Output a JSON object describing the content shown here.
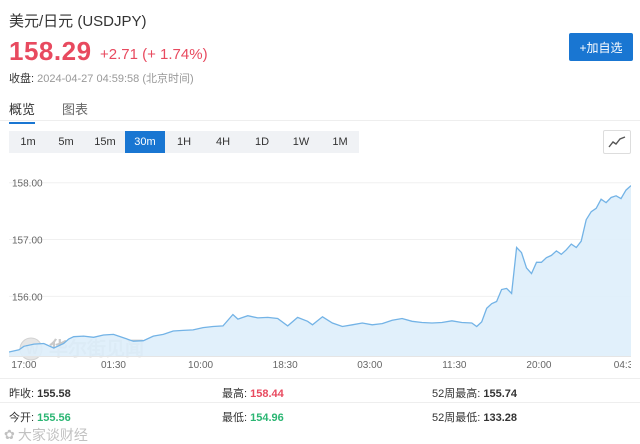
{
  "header": {
    "title": "美元/日元 (USDJPY)",
    "price": "158.29",
    "change": "+2.71 (+ 1.74%)",
    "status_label": "收盘:",
    "timestamp": "2024-04-27 04:59:58 (北京时间)",
    "watch_button": "+加自选"
  },
  "tabs": [
    {
      "label": "概览",
      "active": true
    },
    {
      "label": "图表",
      "active": false
    }
  ],
  "intervals": [
    {
      "label": "1m",
      "active": false
    },
    {
      "label": "5m",
      "active": false
    },
    {
      "label": "15m",
      "active": false
    },
    {
      "label": "30m",
      "active": true
    },
    {
      "label": "1H",
      "active": false
    },
    {
      "label": "4H",
      "active": false
    },
    {
      "label": "1D",
      "active": false
    },
    {
      "label": "1W",
      "active": false
    },
    {
      "label": "1M",
      "active": false
    }
  ],
  "chart_type_icon": "line-chart-icon",
  "chart_data": {
    "type": "area",
    "ylim": [
      154.95,
      158.4
    ],
    "yticks": [
      "158.00",
      "157.00",
      "156.00"
    ],
    "ytick_values": [
      158.0,
      157.0,
      156.0
    ],
    "xlim": [
      0,
      125
    ],
    "xticks": [
      "17:00",
      "01:30",
      "10:00",
      "18:30",
      "03:00",
      "11:30",
      "20:00",
      "04:3"
    ],
    "xtick_positions": [
      3,
      21,
      38.5,
      55.5,
      72.5,
      89.5,
      106.5,
      123.5
    ],
    "watermark": "华尔街见闻",
    "line_color": "#73b3e6",
    "fill_color": "#deeefb",
    "x": [
      0,
      2,
      3,
      5,
      7,
      9,
      11,
      12,
      13,
      15,
      17,
      19,
      21,
      23,
      25,
      27,
      29,
      31,
      33,
      35,
      37,
      39,
      41,
      43,
      45,
      46,
      47,
      48,
      50,
      52,
      54,
      56,
      58,
      60,
      61,
      62,
      63,
      65,
      67,
      69,
      71,
      73,
      75,
      77,
      79,
      81,
      83,
      85,
      87,
      89,
      91,
      93,
      94,
      95,
      96,
      97,
      98,
      99,
      100,
      101,
      102,
      103,
      104,
      105,
      106,
      107,
      108,
      109,
      110,
      111,
      112,
      113,
      114,
      115,
      116,
      117,
      118,
      119,
      120,
      121,
      122,
      123,
      124,
      125
    ],
    "y": [
      155.02,
      155.06,
      155.12,
      155.16,
      155.17,
      155.09,
      155.17,
      155.25,
      155.29,
      155.3,
      155.28,
      155.32,
      155.33,
      155.27,
      155.21,
      155.22,
      155.3,
      155.33,
      155.39,
      155.4,
      155.41,
      155.45,
      155.47,
      155.48,
      155.68,
      155.6,
      155.63,
      155.66,
      155.62,
      155.63,
      155.61,
      155.48,
      155.63,
      155.56,
      155.5,
      155.57,
      155.64,
      155.53,
      155.47,
      155.5,
      155.53,
      155.5,
      155.52,
      155.58,
      155.61,
      155.56,
      155.54,
      155.53,
      155.54,
      155.57,
      155.54,
      155.53,
      155.47,
      155.55,
      155.79,
      155.87,
      155.91,
      156.12,
      156.14,
      156.05,
      156.86,
      156.77,
      156.5,
      156.4,
      156.6,
      156.6,
      156.68,
      156.72,
      156.8,
      156.74,
      156.82,
      156.92,
      156.86,
      156.97,
      157.35,
      157.49,
      157.55,
      157.71,
      157.65,
      157.74,
      157.77,
      157.72,
      157.87,
      157.95,
      158.29
    ]
  },
  "stats": {
    "row1": [
      {
        "label": "昨收:",
        "value": "155.58",
        "tone": "neutral"
      },
      {
        "label": "最高:",
        "value": "158.44",
        "tone": "up"
      },
      {
        "label": "52周最高:",
        "value": "155.74",
        "tone": "neutral"
      }
    ],
    "row2": [
      {
        "label": "今开:",
        "value": "155.56",
        "tone": "down"
      },
      {
        "label": "最低:",
        "value": "154.96",
        "tone": "down"
      },
      {
        "label": "52周最低:",
        "value": "133.28",
        "tone": "neutral"
      }
    ]
  },
  "bottom_watermark": "大家谈财经"
}
